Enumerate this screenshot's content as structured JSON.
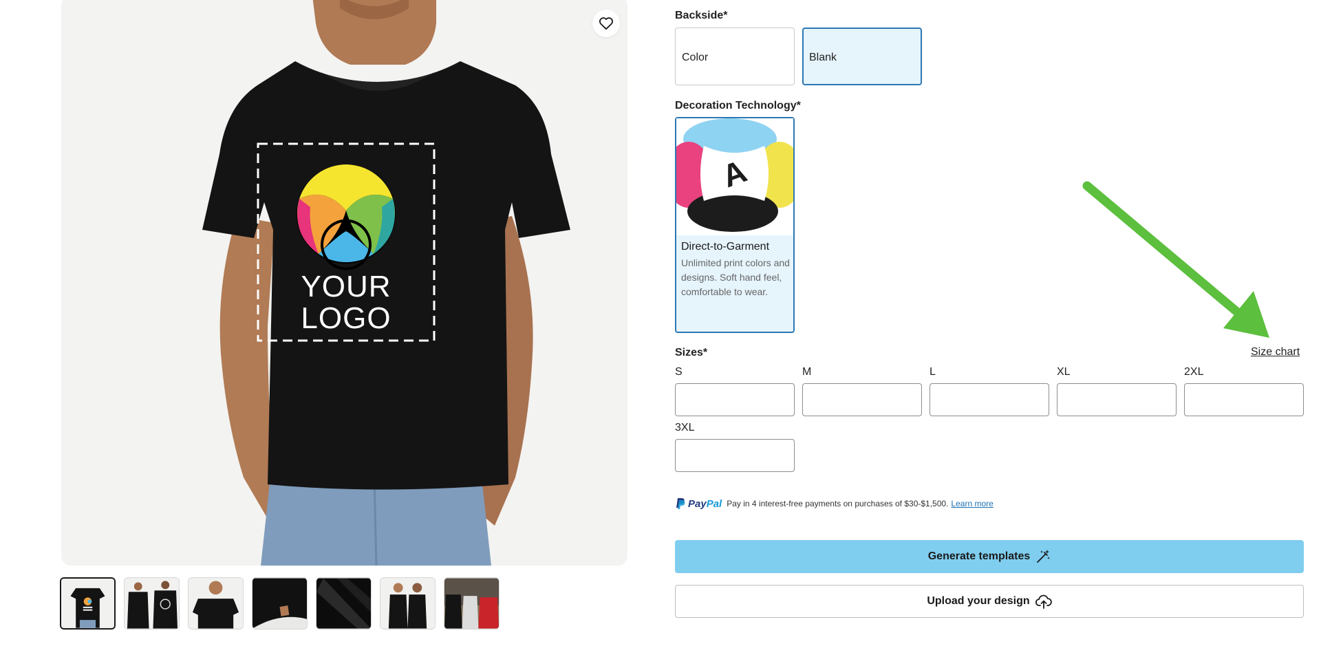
{
  "gallery": {
    "print_area_text_line1": "YOUR",
    "print_area_text_line2": "LOGO",
    "thumbnail_count": 7,
    "active_thumbnail": 1
  },
  "backside": {
    "label": "Backside*",
    "options": [
      "Color",
      "Blank"
    ],
    "selected": "Blank"
  },
  "decoration": {
    "label": "Decoration Technology*",
    "option_name": "Direct-to-Garment",
    "option_desc": "Unlimited print colors and designs. Soft hand feel, comfortable to wear."
  },
  "sizes": {
    "label": "Sizes*",
    "size_chart_link": "Size chart",
    "items": [
      "S",
      "M",
      "L",
      "XL",
      "2XL",
      "3XL"
    ]
  },
  "paypal": {
    "brand_pay": "Pay",
    "brand_pal": "Pal",
    "message": "Pay in 4 interest-free payments on purchases of $30-$1,500.",
    "learn_more": "Learn more"
  },
  "actions": {
    "generate_label": "Generate templates",
    "upload_label": "Upload your design"
  },
  "colors": {
    "accent_selected_border": "#2b78b3",
    "accent_selected_bg": "#e6f4fc",
    "generate_button": "#7fcdef",
    "annotation_arrow": "#5cbf3e",
    "paypal_blue_dark": "#253b80",
    "paypal_blue_light": "#179bd7"
  },
  "icons": {
    "favorite": "heart-icon",
    "generate": "magic-wand-icon",
    "upload": "cloud-upload-icon",
    "paypal": "paypal-logo"
  }
}
